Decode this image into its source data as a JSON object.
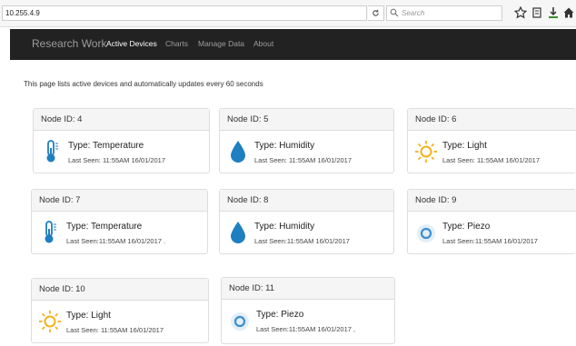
{
  "browser": {
    "url": "10.255.4.9",
    "search_placeholder": "Search"
  },
  "navbar": {
    "brand": "Research Work",
    "items": [
      {
        "label": "Active Devices",
        "active": true
      },
      {
        "label": "Charts",
        "active": false
      },
      {
        "label": "Manage Data",
        "active": false
      },
      {
        "label": "About",
        "active": false
      }
    ]
  },
  "intro": "This page lists active devices and automatically updates every 60 seconds",
  "devices": [
    {
      "node_label": "Node ID:",
      "node_id": "4",
      "type": "Type: Temperature",
      "last_seen": "Last Seen: 11:55AM 16/01/2017",
      "icon": "thermometer-icon"
    },
    {
      "node_label": "Node ID:",
      "node_id": "5",
      "type": "Type: Humidity",
      "last_seen": "Last Seen: 11:55AM 16/01/2017",
      "icon": "water-drop-icon"
    },
    {
      "node_label": "Node ID:",
      "node_id": "6",
      "type": "Type: Light",
      "last_seen": "Last Seen: 11:55AM 16/01/2017",
      "icon": "sun-icon"
    },
    {
      "node_label": "Node ID:",
      "node_id": "7",
      "type": "Type: Temperature",
      "last_seen": "Last Seen:11:55AM 16/01/2017 .",
      "icon": "thermometer-icon"
    },
    {
      "node_label": "Node ID:",
      "node_id": "8",
      "type": "Type: Humidity",
      "last_seen": "Last Seen:11:55AM 16/01/2017",
      "icon": "water-drop-icon"
    },
    {
      "node_label": "Node ID:",
      "node_id": "9",
      "type": "Type: Piezo",
      "last_seen": "Last Seen:11:55AM 16/01/2017",
      "icon": "piezo-icon"
    },
    {
      "node_label": "Node ID:",
      "node_id": "10",
      "type": "Type: Light",
      "last_seen": "Last Seen: 11:55AM 16/01/2017",
      "icon": "sun-icon"
    },
    {
      "node_label": "Node ID:",
      "node_id": "11",
      "type": "Type: Piezo",
      "last_seen": "Last Seen:11:55AM 16/01/2017 ,",
      "icon": "piezo-icon"
    }
  ],
  "colors": {
    "navbar_bg": "#222222",
    "thermometer": "#1e7fc1",
    "drop": "#1e7fc1",
    "sun": "#f3b21b",
    "piezo": "#3a8fd0"
  }
}
